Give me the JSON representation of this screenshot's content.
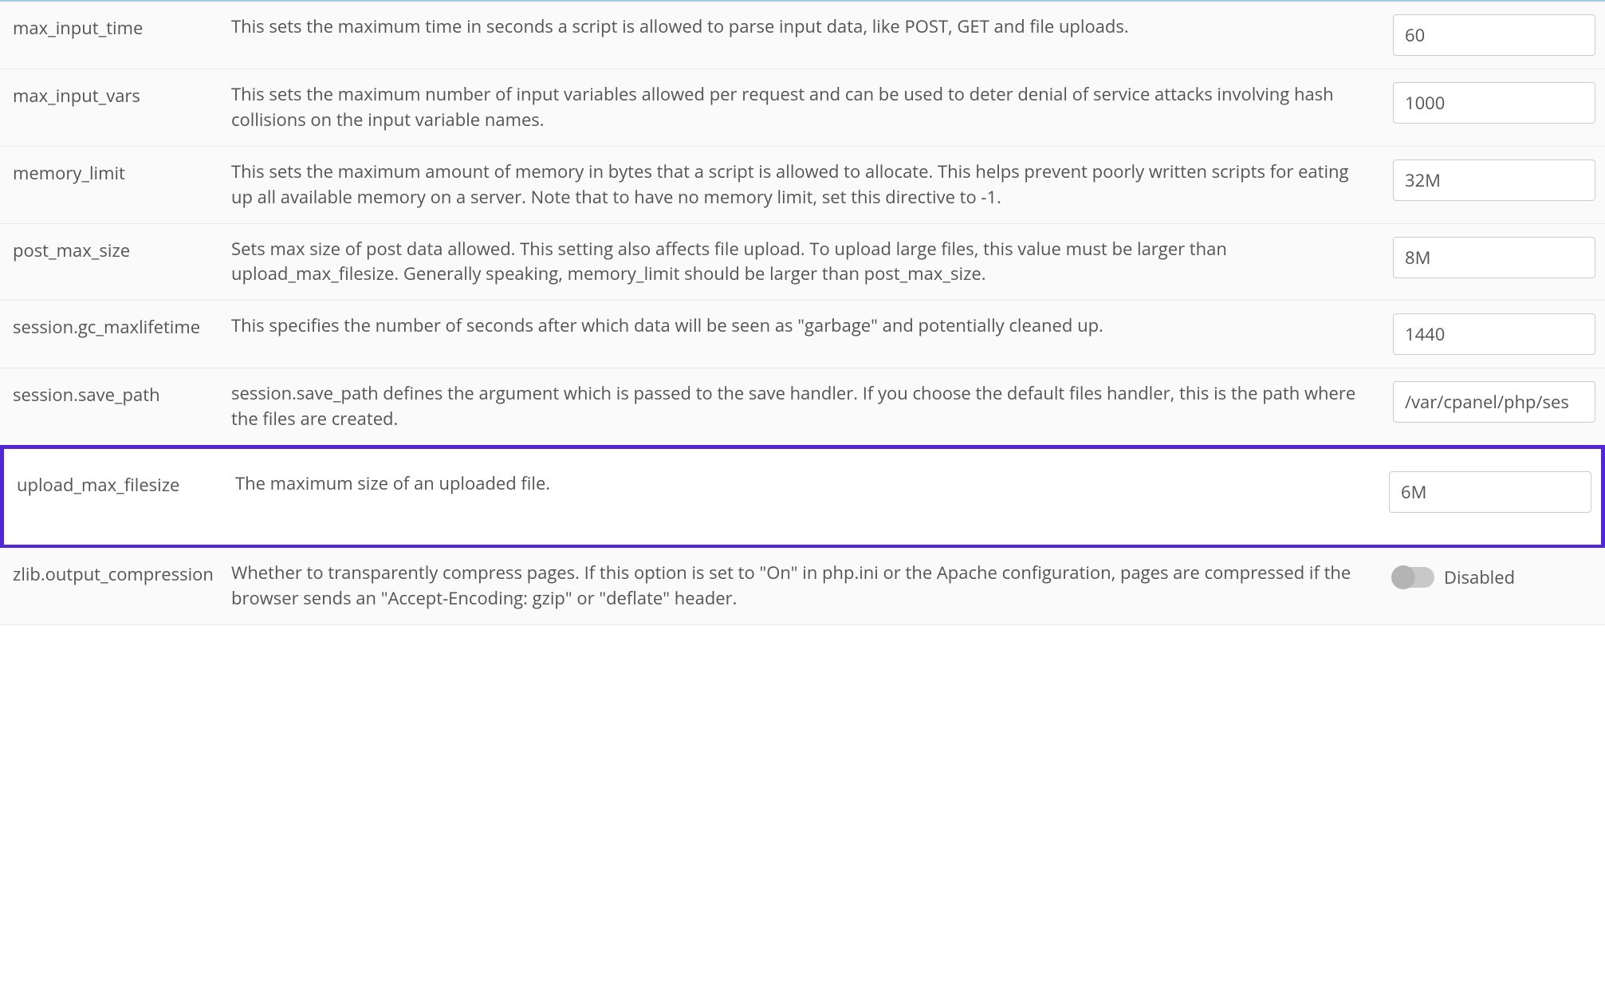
{
  "rows": [
    {
      "name": "max_input_time",
      "description": "This sets the maximum time in seconds a script is allowed to parse input data, like POST, GET and file uploads.",
      "value": "60",
      "type": "text",
      "highlighted": false
    },
    {
      "name": "max_input_vars",
      "description": "This sets the maximum number of input variables allowed per request and can be used to deter denial of service attacks involving hash collisions on the input variable names.",
      "value": "1000",
      "type": "text",
      "highlighted": false
    },
    {
      "name": "memory_limit",
      "description": "This sets the maximum amount of memory in bytes that a script is allowed to allocate. This helps prevent poorly written scripts for eating up all available memory on a server. Note that to have no memory limit, set this directive to -1.",
      "value": "32M",
      "type": "text",
      "highlighted": false
    },
    {
      "name": "post_max_size",
      "description": "Sets max size of post data allowed. This setting also affects file upload. To upload large files, this value must be larger than upload_max_filesize. Generally speaking, memory_limit should be larger than post_max_size.",
      "value": "8M",
      "type": "text",
      "highlighted": false
    },
    {
      "name": "session.gc_maxlifetime",
      "description": "This specifies the number of seconds after which data will be seen as \"garbage\" and potentially cleaned up.",
      "value": "1440",
      "type": "text",
      "highlighted": false
    },
    {
      "name": "session.save_path",
      "description": "session.save_path defines the argument which is passed to the save handler. If you choose the default files handler, this is the path where the files are created.",
      "value": "/var/cpanel/php/ses",
      "type": "text",
      "highlighted": false
    },
    {
      "name": "upload_max_filesize",
      "description": "The maximum size of an uploaded file.",
      "value": "6M",
      "type": "text",
      "highlighted": true
    },
    {
      "name": "zlib.output_compression",
      "description": "Whether to transparently compress pages. If this option is set to \"On\" in php.ini or the Apache configuration, pages are compressed if the browser sends an \"Accept-Encoding: gzip\" or \"deflate\" header.",
      "value": "Disabled",
      "type": "toggle",
      "highlighted": false
    }
  ]
}
